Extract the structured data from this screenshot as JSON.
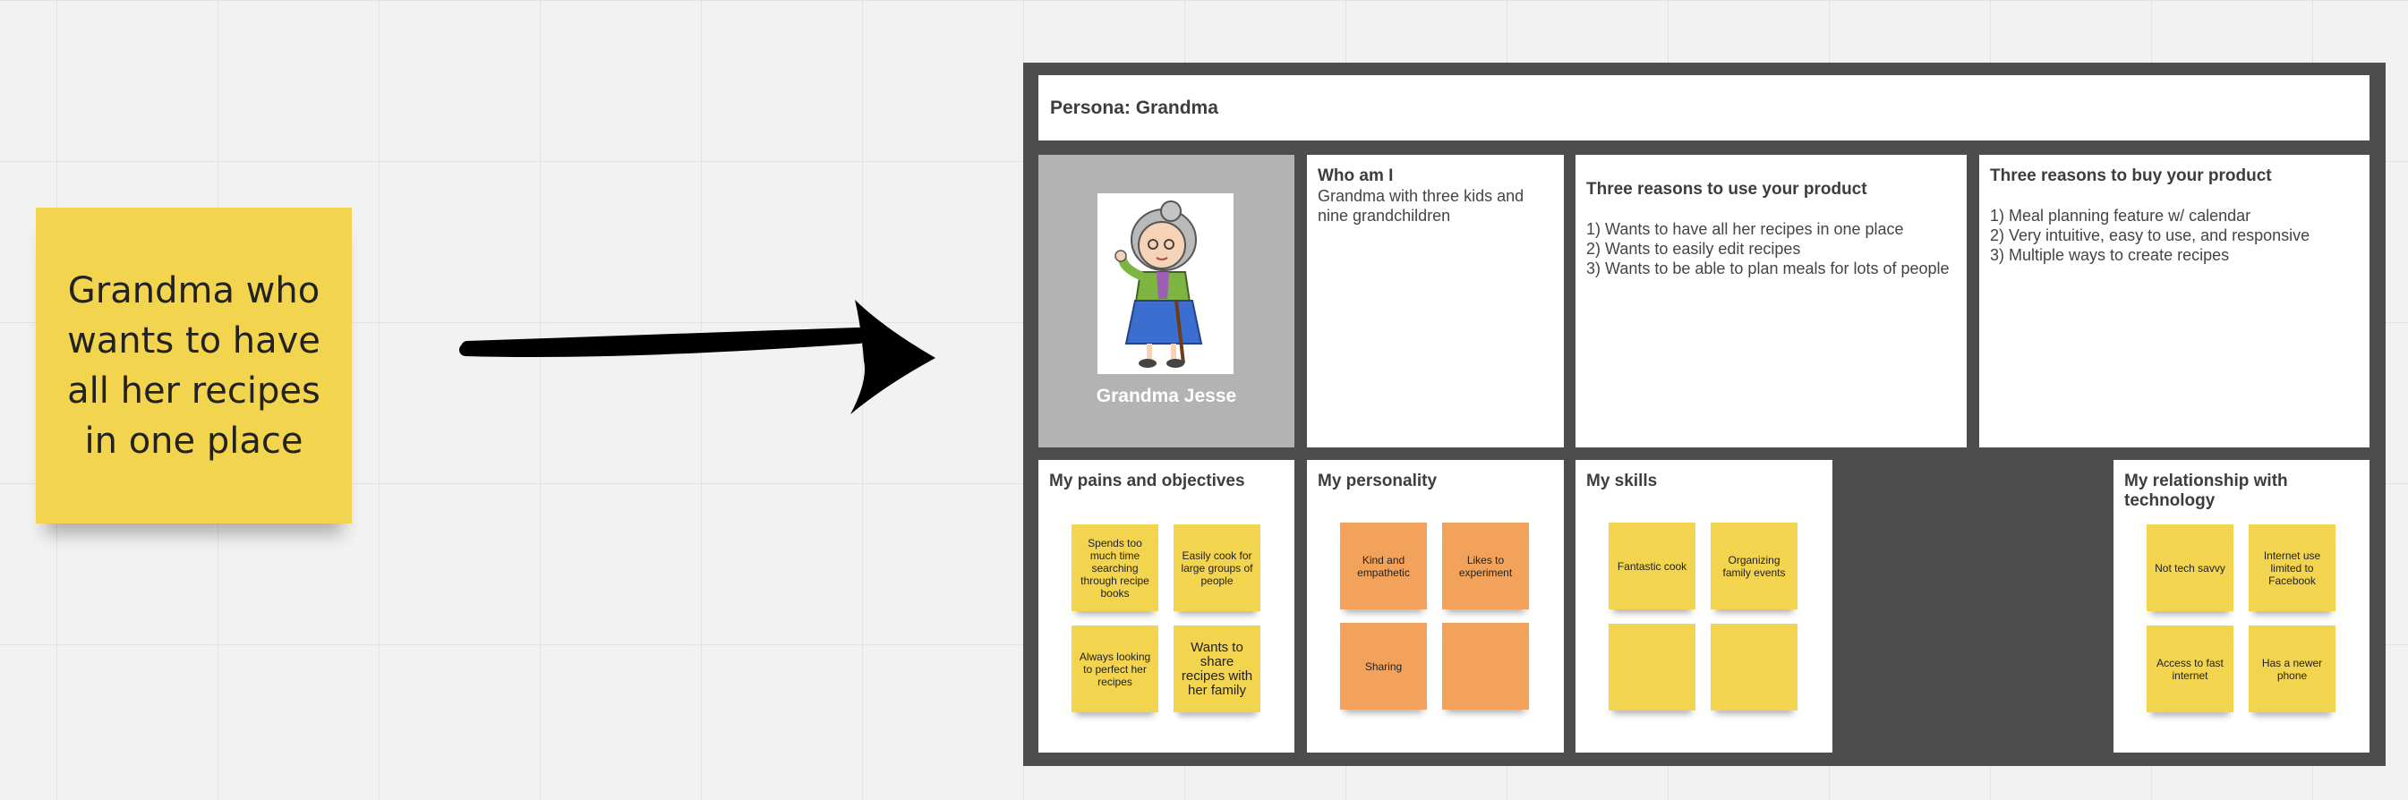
{
  "sticky": {
    "text": "Grandma who wants to have all her recipes in one place"
  },
  "persona": {
    "title": "Persona: Grandma",
    "name": "Grandma Jesse",
    "who": {
      "heading": "Who am I",
      "body": "Grandma with three kids and nine grandchildren"
    },
    "use": {
      "heading": "Three reasons to use your product",
      "lines": [
        "1) Wants to have all her recipes in one place",
        "2) Wants to easily edit recipes",
        "3) Wants to be able to plan meals for lots of people"
      ]
    },
    "buy": {
      "heading": "Three reasons to buy your product",
      "lines": [
        "1) Meal planning feature w/ calendar",
        "2) Very intuitive, easy to use, and responsive",
        "3) Multiple ways to create recipes"
      ]
    },
    "pains": {
      "heading": "My pains and objectives",
      "notes": [
        "Spends too much time searching through recipe books",
        "Easily cook for large groups of people",
        "Always looking to perfect her recipes",
        "Wants to share recipes with her family"
      ]
    },
    "personality": {
      "heading": "My personality",
      "notes": [
        "Kind and empathetic",
        "Likes to experiment",
        "Sharing",
        ""
      ]
    },
    "skills": {
      "heading": "My skills",
      "notes": [
        "Fantastic cook",
        "Organizing family events",
        "",
        ""
      ]
    },
    "tech": {
      "heading": "My relationship with technology",
      "notes": [
        "Not tech savvy",
        "Internet use limited to Facebook",
        "Access to fast internet",
        "Has a newer phone"
      ]
    }
  },
  "colors": {
    "sticky_yellow": "#f3d44e",
    "sticky_orange": "#f2a25a",
    "board": "#4d4d4d",
    "canvas": "#f2f2f2"
  },
  "icons": {
    "arrow": "arrow-right-icon",
    "avatar": "grandma-illustration"
  }
}
